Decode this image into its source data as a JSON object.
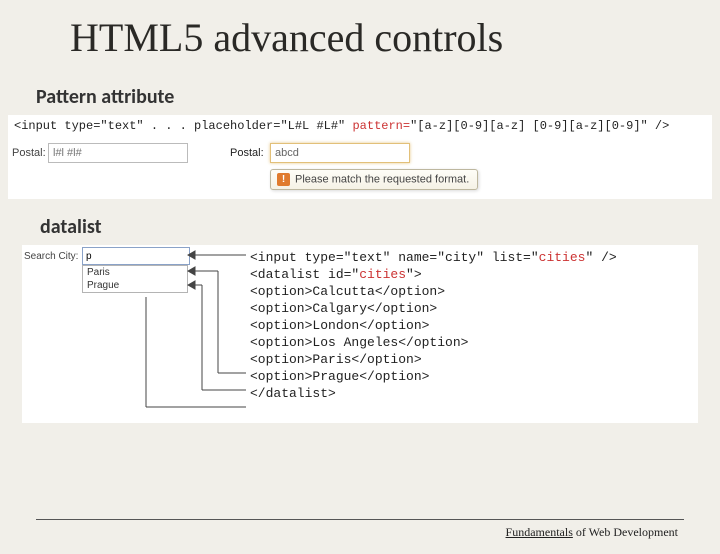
{
  "title": "HTML5 advanced controls",
  "sections": {
    "pattern": {
      "heading": "Pattern attribute"
    },
    "datalist": {
      "heading": "datalist"
    }
  },
  "pattern_code": {
    "p1": "<input type=\"text\" . . . placeholder=\"L#L #L#\" ",
    "highlight": "pattern=",
    "p2": "\"[a-z][0-9][a-z] [0-9][a-z][0-9]\"  />"
  },
  "pattern_demo": {
    "label1": "Postal:",
    "placeholder1": "l#l #l#",
    "label2": "Postal:",
    "value2": "abcd",
    "tooltip_icon": "!",
    "tooltip_text": "Please match the requested format."
  },
  "datalist": {
    "search_label": "Search City:",
    "search_value": "p",
    "options_visible": [
      "Paris",
      "Prague"
    ],
    "code": {
      "l1a": "<input type=\"text\" name=\"city\" list=\"",
      "l1b": "cities",
      "l1c": "\"  />",
      "l2": "",
      "l3a": "<datalist id=\"",
      "l3b": "cities",
      "l3c": "\">",
      "l4": "  <option>Calcutta</option>",
      "l5": "  <option>Calgary</option>",
      "l6": "  <option>London</option>",
      "l7": "  <option>Los Angeles</option>",
      "l8": "  <option>Paris</option>",
      "l9": "  <option>Prague</option>",
      "l10": "</datalist>"
    }
  },
  "footer": {
    "underlined": "Fundamentals",
    "rest": " of Web Development"
  }
}
